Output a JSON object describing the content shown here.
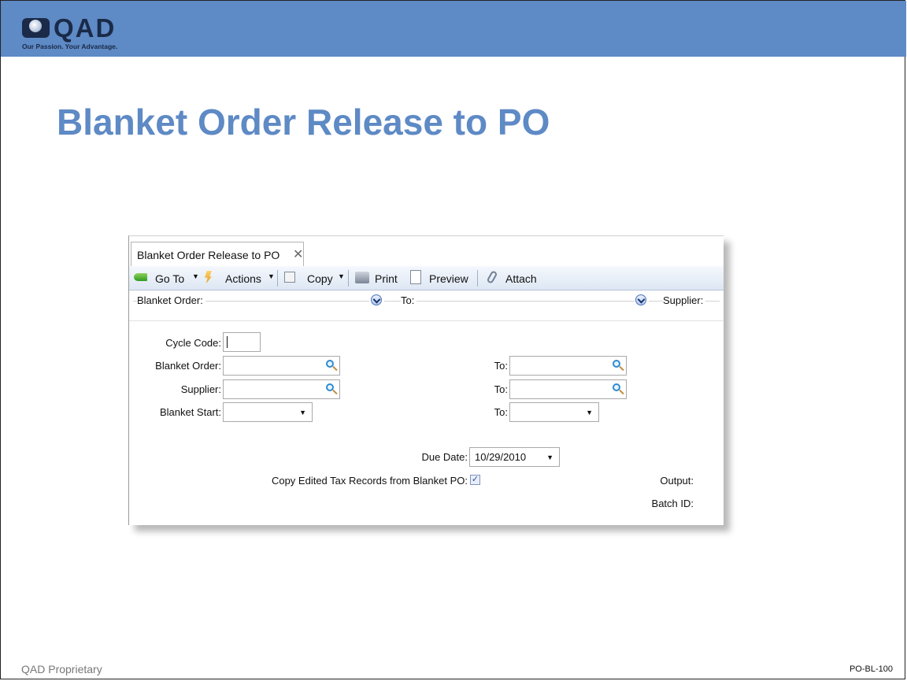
{
  "header": {
    "logo_text": "QAD",
    "logo_tagline": "Our Passion. Your Advantage.",
    "colors": {
      "bar": "#5e8ac5",
      "logo": "#1a2a48"
    }
  },
  "slide": {
    "title": "Blanket Order Release to PO",
    "title_color": "#5e8ac5"
  },
  "window": {
    "tab_label": "Blanket Order Release to PO",
    "tab_close": "✕",
    "toolbar": {
      "goto_label": "Go To",
      "actions_label": "Actions",
      "copy_label": "Copy",
      "print_label": "Print",
      "preview_label": "Preview",
      "attach_label": "Attach",
      "dropdown_arrow": "▼"
    },
    "filter": {
      "blanket_order_label": "Blanket Order:",
      "to_label": "To:",
      "supplier_label": "Supplier:"
    },
    "form": {
      "cycle_code_label": "Cycle Code:",
      "cycle_code_value": "",
      "blanket_order_label": "Blanket Order:",
      "blanket_order_value": "",
      "blanket_order_to_label": "To:",
      "blanket_order_to_value": "",
      "supplier_label": "Supplier:",
      "supplier_value": "",
      "supplier_to_label": "To:",
      "supplier_to_value": "",
      "blanket_start_label": "Blanket Start:",
      "blanket_start_value": "",
      "blanket_start_to_label": "To:",
      "blanket_start_to_value": "",
      "due_date_label": "Due Date:",
      "due_date_value": "10/29/2010",
      "copy_tax_label": "Copy Edited Tax Records from Blanket PO:",
      "copy_tax_checked": true,
      "copy_tax_mark": "✓",
      "output_label": "Output:",
      "batch_id_label": "Batch ID:"
    }
  },
  "footer": {
    "left": "QAD Proprietary",
    "right": "PO-BL-100"
  }
}
